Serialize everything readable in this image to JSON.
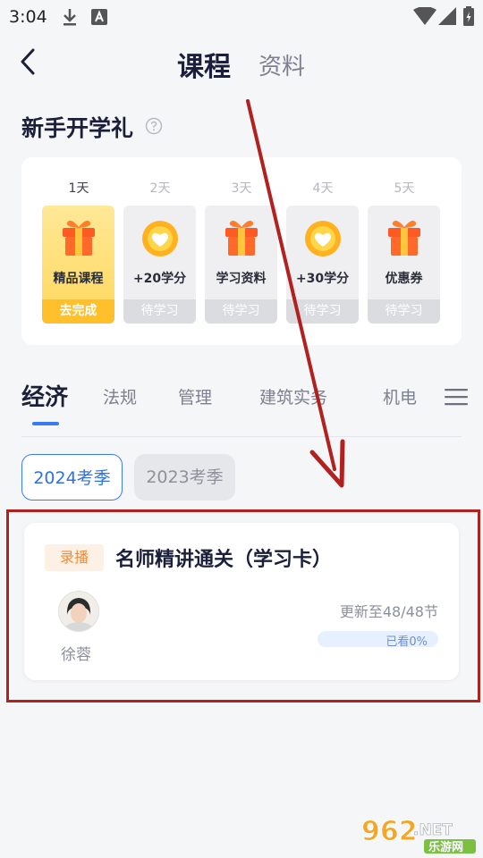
{
  "status_bar": {
    "time": "3:04",
    "icons": [
      "download-icon",
      "a-badge-icon",
      "wifi-icon",
      "cell-signal-icon",
      "battery-icon"
    ]
  },
  "header": {
    "back_icon": "chevron-left-icon",
    "tabs": [
      "课程",
      "资料"
    ],
    "active_tab": 0
  },
  "gift": {
    "title": "新手开学礼",
    "help_icon": "question-circle-icon",
    "days": [
      {
        "day": "1天",
        "label": "精品课程",
        "action": "去完成",
        "icon": "gift-box-icon",
        "active": true
      },
      {
        "day": "2天",
        "label": "+20学分",
        "action": "待学习",
        "icon": "heart-coin-icon",
        "active": false
      },
      {
        "day": "3天",
        "label": "学习资料",
        "action": "待学习",
        "icon": "gift-box-icon",
        "active": false
      },
      {
        "day": "4天",
        "label": "+30学分",
        "action": "待学习",
        "icon": "heart-coin-icon",
        "active": false
      },
      {
        "day": "5天",
        "label": "优惠券",
        "action": "待学习",
        "icon": "gift-box-icon",
        "active": false
      }
    ]
  },
  "categories": {
    "items": [
      "经济",
      "法规",
      "管理",
      "建筑实务",
      "机电"
    ],
    "active": 0,
    "menu_icon": "hamburger-menu-icon"
  },
  "seasons": {
    "items": [
      "2024考季",
      "2023考季"
    ],
    "active": 0
  },
  "course": {
    "tag": "录播",
    "title": "名师精讲通关（学习卡）",
    "teacher": "徐蓉",
    "update": "更新至48/48节",
    "progress_text": "已看0%",
    "progress": 0
  },
  "watermark": {
    "brand": "962",
    "suffix": ".NET",
    "subtitle": "乐游网"
  },
  "colors": {
    "accent": "#3a7bf4",
    "highlight_box": "#b0211f",
    "gift_active": "#ffd75b",
    "tag": "#ef8b38"
  }
}
